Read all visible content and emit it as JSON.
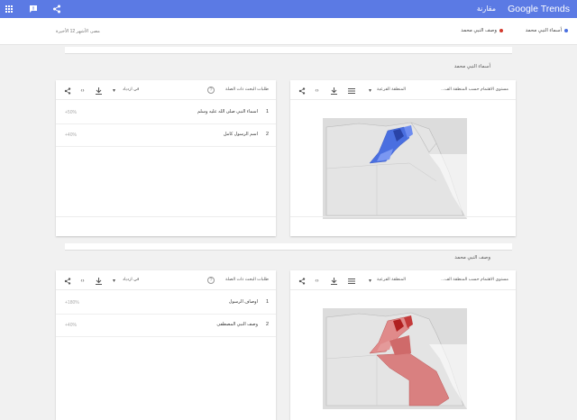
{
  "header": {
    "logo": "Google Trends",
    "title": "مقارنة",
    "icons": [
      "apps-icon",
      "feedback-icon",
      "share-icon"
    ]
  },
  "terms": [
    {
      "label": "أسماء النبي محمد",
      "color": "#4a6fe0"
    },
    {
      "label": "وصف النبي محمد",
      "color": "#d33a2e"
    }
  ],
  "period": "مصر، الأشهر 12 الأخيرة",
  "sections": [
    {
      "title": "أسماء النبي محمد",
      "map": {
        "label": "مستوى الاهتمام حسب المنطقة الف...",
        "select": "المنطقة الفرعية",
        "color": "#4a6fe0"
      },
      "related": {
        "label": "طلبات البحث ذات الصلة",
        "select": "في ازدياد",
        "rows": [
          {
            "rank": "1",
            "name": "اسماء النبي صلى الله عليه وسلم",
            "value": "+50%"
          },
          {
            "rank": "2",
            "name": "اسم الرسول كامل",
            "value": "+40%"
          }
        ]
      }
    },
    {
      "title": "وصف النبي محمد",
      "map": {
        "label": "مستوى الاهتمام حسب المنطقة الف...",
        "select": "المنطقة الفرعية",
        "color": "#d33a2e"
      },
      "related": {
        "label": "طلبات البحث ذات الصلة",
        "select": "في ازدياد",
        "rows": [
          {
            "rank": "1",
            "name": "اوصاف الرسول",
            "value": "+180%"
          },
          {
            "rank": "2",
            "name": "وصف النبي المصطفى",
            "value": "+40%"
          }
        ]
      }
    }
  ]
}
